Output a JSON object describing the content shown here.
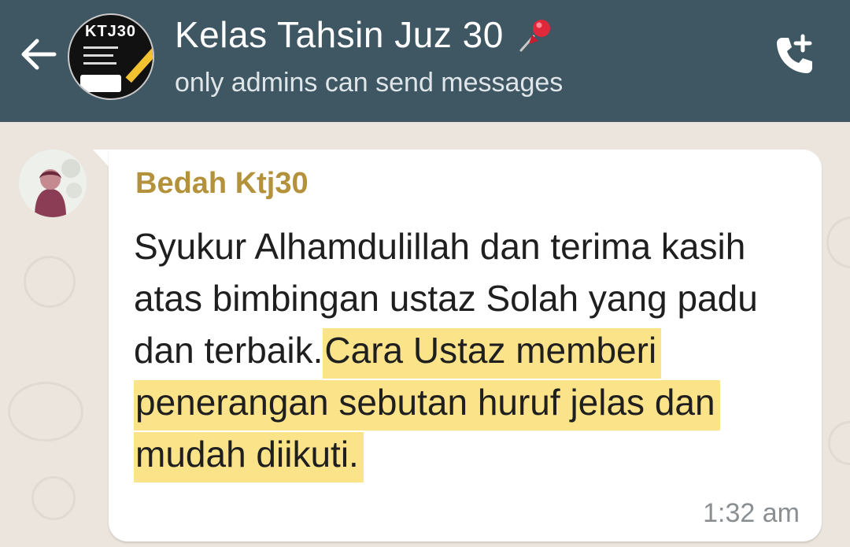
{
  "header": {
    "title": "Kelas Tahsin Juz 30",
    "subtitle": "only admins can send messages",
    "avatar_text": "KTJ30",
    "back_icon": "arrow-left-icon",
    "pin_icon": "pushpin-icon",
    "call_icon": "add-call-icon"
  },
  "message": {
    "sender": "Bedah Ktj30",
    "text_plain": "Syukur Alhamdulillah dan terima kasih atas bimbingan ustaz Solah yang padu dan terbaik.",
    "text_highlighted": "Cara Ustaz memberi  penerangan sebutan huruf jelas dan mudah diikuti.",
    "time": "1:32 am"
  },
  "colors": {
    "header_bg": "#3f5663",
    "sender_name": "#b4923c",
    "highlight": "#fbe38a",
    "chat_bg": "#ebe5de"
  }
}
